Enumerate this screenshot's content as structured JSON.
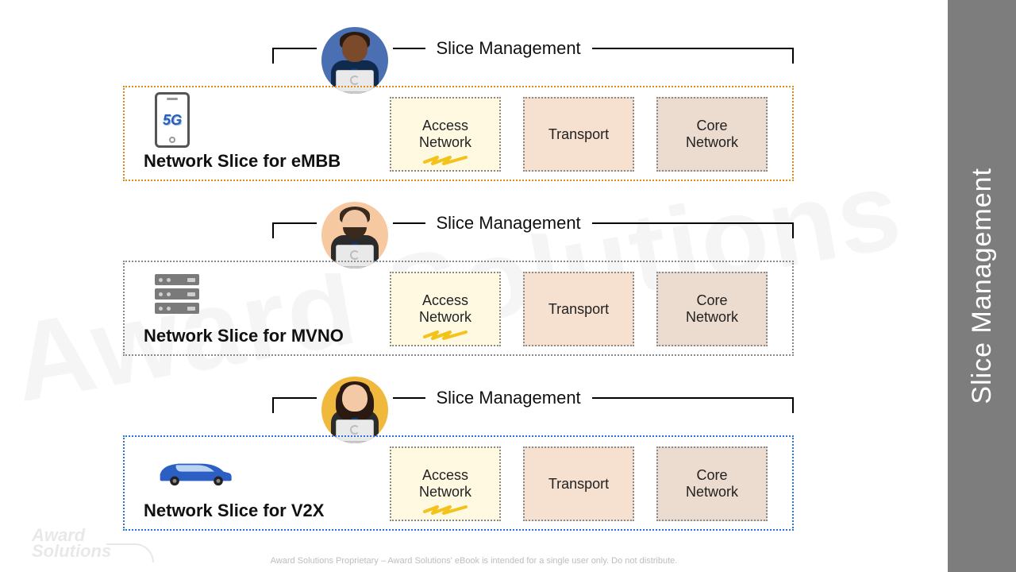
{
  "side_title": "Slice Management",
  "bracket_label": "Slice Management",
  "components": {
    "access": "Access\nNetwork",
    "transport": "Transport",
    "core": "Core\nNetwork"
  },
  "slices": [
    {
      "id": "embb",
      "label": "Network Slice for eMBB",
      "border_color": "#e08a1e",
      "icon": "phone5g"
    },
    {
      "id": "mvno",
      "label": "Network Slice for MVNO",
      "border_color": "#8a8a8a",
      "icon": "server"
    },
    {
      "id": "v2x",
      "label": "Network Slice for V2X",
      "border_color": "#2e74d6",
      "icon": "car"
    }
  ],
  "avatars": [
    {
      "bg": "#4a6fb3",
      "skin": "#7a4a2a",
      "hair": "#2b1a12",
      "suit": "#102a4d"
    },
    {
      "bg": "#f7c9a0",
      "skin": "#f1c6a3",
      "hair": "#3a2a1e",
      "suit": "#2b2b2b"
    },
    {
      "bg": "#f0b83c",
      "skin": "#f3c9a6",
      "hair": "#2b1a12",
      "suit": "#2b2b2b"
    }
  ],
  "watermark": "Award Solutions",
  "logo_text": "Award\nSolutions",
  "footer": "Award Solutions Proprietary – Award Solutions' eBook is intended for a single user only. Do not distribute."
}
